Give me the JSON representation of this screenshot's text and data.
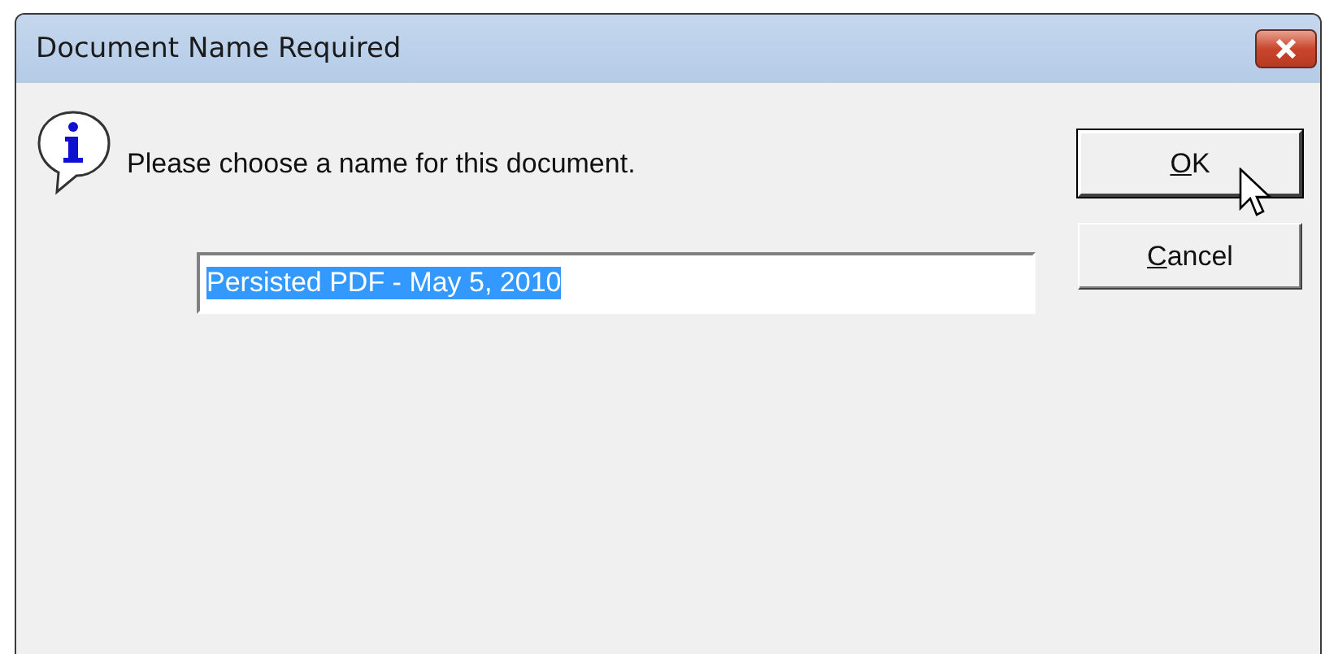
{
  "window": {
    "title": "Document Name Required"
  },
  "message": "Please choose a name for this document.",
  "name_field": {
    "value": "Persisted PDF - May 5, 2010",
    "selected": true
  },
  "buttons": [
    {
      "underlined": "O",
      "rest": "K",
      "default": true
    },
    {
      "underlined": "C",
      "rest": "ancel",
      "default": false
    }
  ]
}
